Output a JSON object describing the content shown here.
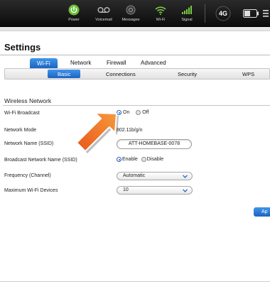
{
  "topbar": {
    "items": [
      {
        "label": "Power",
        "icon": "power-icon"
      },
      {
        "label": "Voicemail",
        "icon": "voicemail-icon"
      },
      {
        "label": "Messages",
        "icon": "messages-icon"
      },
      {
        "label": "Wi-Fi",
        "icon": "wifi-icon"
      },
      {
        "label": "Signal",
        "icon": "signal-icon"
      }
    ],
    "network_badge": "4G",
    "accent_green": "#7ac943"
  },
  "page": {
    "title": "Settings"
  },
  "tabs": [
    {
      "label": "Wi-Fi",
      "active": true
    },
    {
      "label": "Network",
      "active": false
    },
    {
      "label": "Firewall",
      "active": false
    },
    {
      "label": "Advanced",
      "active": false
    }
  ],
  "subtabs": [
    {
      "label": "Basic",
      "active": true
    },
    {
      "label": "Connections",
      "active": false
    },
    {
      "label": "Security",
      "active": false
    },
    {
      "label": "WPS",
      "active": false
    }
  ],
  "section": {
    "heading": "Wireless Network"
  },
  "fields": {
    "broadcast": {
      "label": "Wi-Fi Broadcast",
      "options": [
        "On",
        "Off"
      ],
      "selected": "On"
    },
    "mode": {
      "label": "Network Mode",
      "value": "802.11b/g/n"
    },
    "ssid": {
      "label": "Network Name (SSID)",
      "value": "ATT-HOMEBASE-0078"
    },
    "broadcast_ssid": {
      "label": "Broadcast Network Name (SSID)",
      "options": [
        "Enable",
        "Disable"
      ],
      "selected": "Enable"
    },
    "frequency": {
      "label": "Frequency (Channel)",
      "value": "Automatic"
    },
    "max_devices": {
      "label": "Maximum Wi-Fi Devices",
      "value": "10"
    }
  },
  "apply_label": "Ap",
  "colors": {
    "accent_blue": "#1b63c3",
    "arrow_orange": "#f2641e"
  }
}
